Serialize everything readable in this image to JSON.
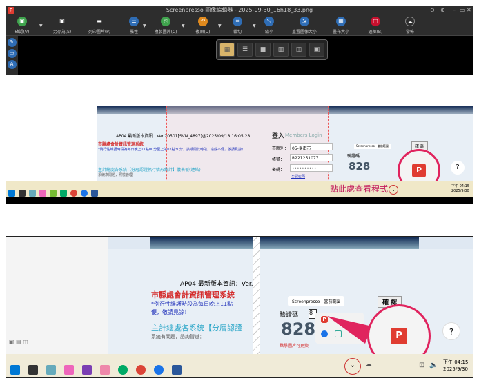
{
  "editor": {
    "title": "Screenpresso 圖像編輯器 - 2025-09-30_16h18_33.png",
    "window_controls": [
      "⊖",
      "⊕",
      "–",
      "▭",
      "✕"
    ],
    "toolbar": [
      {
        "label": "確認(V)",
        "icon": "save-icon",
        "color": "#3fa34d"
      },
      {
        "label": "另存為(S)",
        "icon": "floppy-icon",
        "color": "#2d2d2d"
      },
      {
        "label": "列印圖片(P)",
        "icon": "printer-icon",
        "color": "#2d2d2d"
      },
      {
        "label": "屬性",
        "icon": "list-icon",
        "color": "#2f6db5"
      },
      {
        "label": "複製圖片(C)",
        "icon": "copy-icon",
        "color": "#3fa34d"
      },
      {
        "label": "復原(U)",
        "icon": "undo-icon",
        "color": "#e08a1e"
      },
      {
        "label": "裁切",
        "icon": "crop-icon",
        "color": "#2f6db5"
      },
      {
        "label": "縮小",
        "icon": "shrink-icon",
        "color": "#2f6db5"
      },
      {
        "label": "重置圖像大小",
        "icon": "resize-icon",
        "color": "#2f6db5"
      },
      {
        "label": "畫布大小",
        "icon": "canvas-icon",
        "color": "#2f6db5"
      },
      {
        "label": "邊框(B)",
        "icon": "border-icon",
        "color": "#c8102e"
      },
      {
        "label": "發佈",
        "icon": "cloud-icon",
        "color": "#2d2d2d"
      }
    ],
    "left_tools": [
      "pen-icon",
      "rectangle-icon",
      "text-icon"
    ]
  },
  "mid": {
    "version": "AP04 最新版本資訊：Ver.20501[SVN_4897]@2025/09/18 16:05:28",
    "system_title": "市縣處會計資訊管理系統",
    "notice": "*例行性維護時段為每日晚上11點00分至上午07點30分，該期間此時段，造成不便，敬請見諒！",
    "link": "主計總處各系統【分層認證執行情形統計】儀表板(連結)",
    "sub": "系統來問題，照檢管理",
    "login_title": "登入",
    "login_sub": "Members Login",
    "city_label": "市縣別：",
    "city_value": "05-臺南市",
    "account_label": "帳號：",
    "account_value": "R221251077",
    "password_label": "密碼：",
    "password_value": "••••••••••",
    "forgot": "忘記密碼",
    "tooltip": "Screenpresso - 當前範圍",
    "confirm": "確 認",
    "captcha_label": "驗證碼",
    "captcha": "828",
    "annotation": "點此處查看程式",
    "clock_time": "下午 04:15",
    "clock_date": "2025/9/30"
  },
  "bot": {
    "version": "AP04 最新版本資訊：Ver.",
    "system_title": "市縣處會計資訊管理系統",
    "notice": "*例行性維護時段為每日晚上11點",
    "notice2": "便，敬請見諒！",
    "link": "主計總處各系統【分層認證",
    "sub": "系統有問題，諮詢管道：",
    "tooltip": "Screenpresso - 當前範圍",
    "confirm": "確 認",
    "captcha_label": "驗證碼",
    "captcha_input": "8",
    "captcha": "828",
    "captcha_hint": "點擊圖片可更換",
    "clock_time": "下午 04:15",
    "clock_date": "2025/9/30"
  }
}
